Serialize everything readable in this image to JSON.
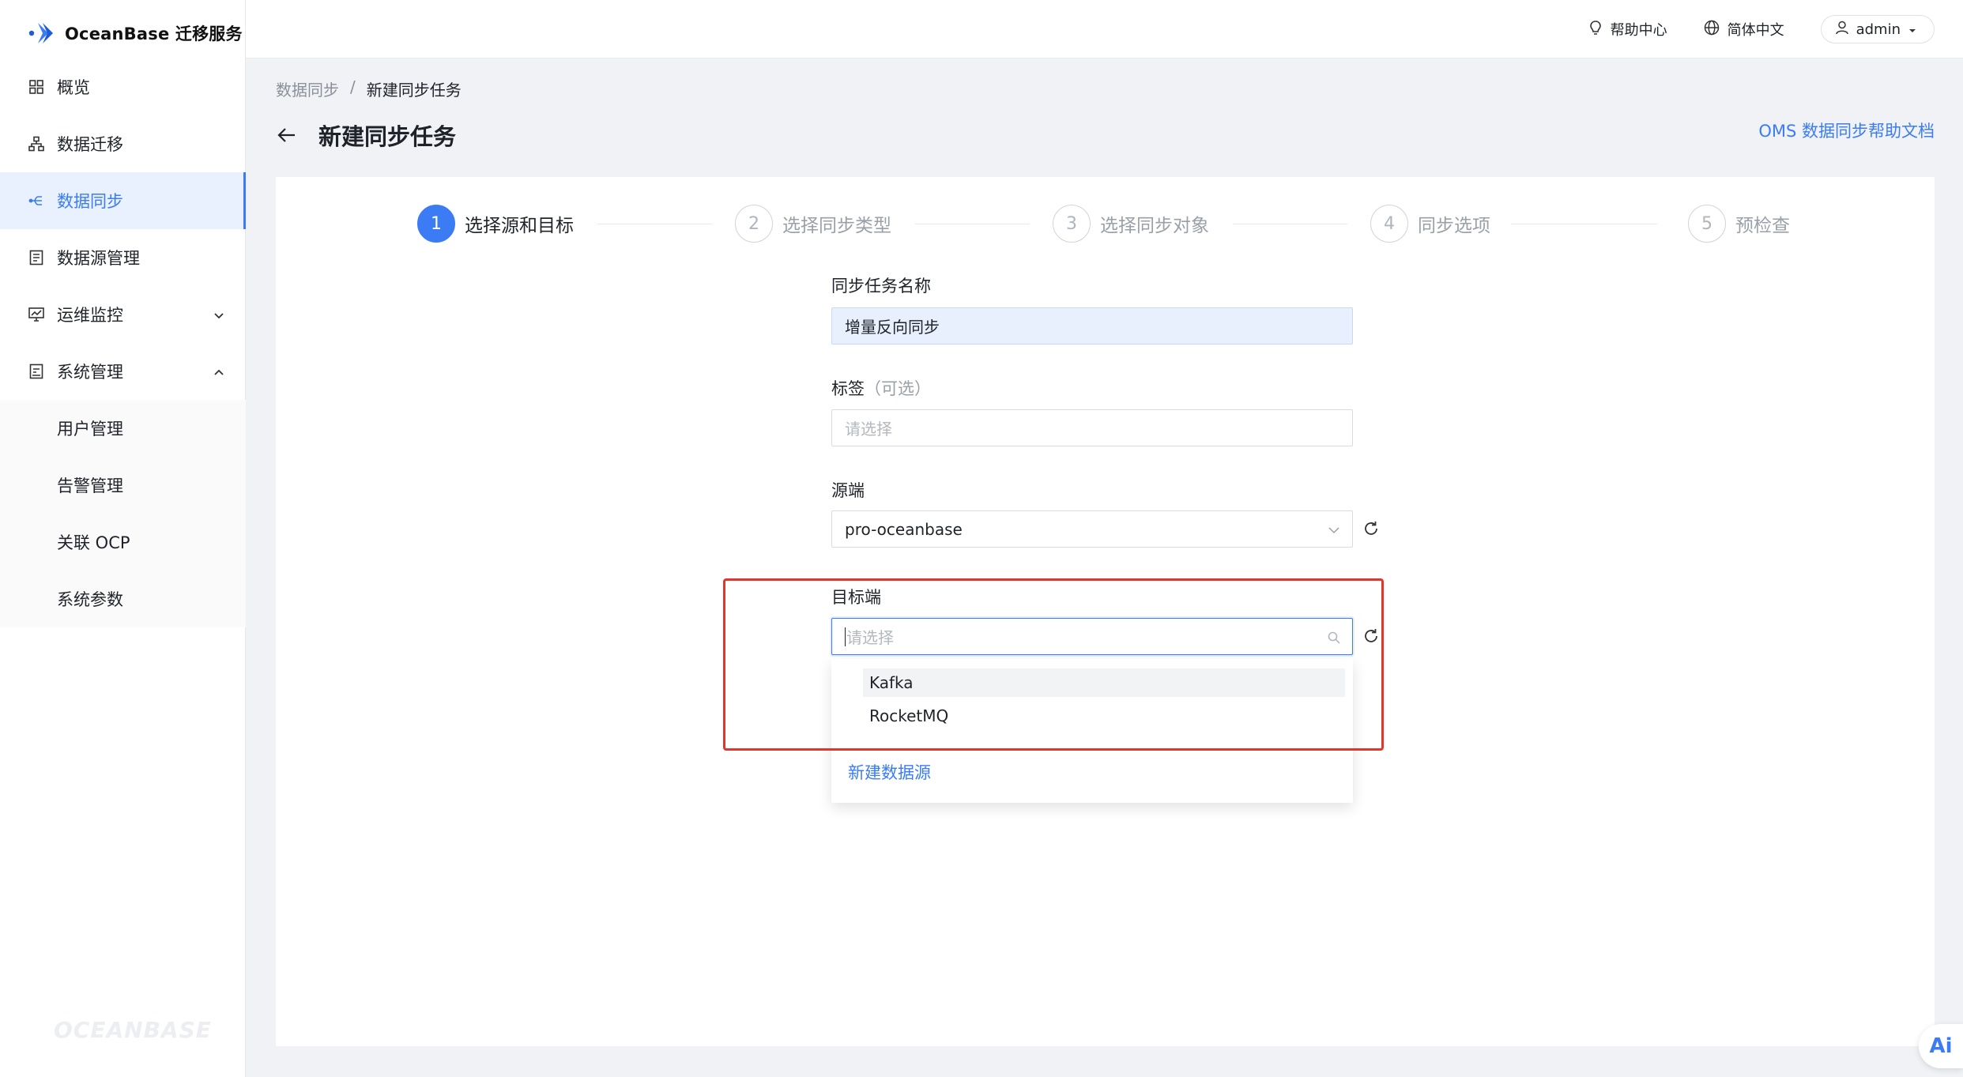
{
  "app": {
    "logo_text": "OceanBase 迁移服务",
    "footer_brand": "OCEANBASE"
  },
  "header": {
    "help": "帮助中心",
    "language": "简体中文",
    "user": "admin"
  },
  "sidebar": {
    "items": [
      {
        "label": "概览"
      },
      {
        "label": "数据迁移"
      },
      {
        "label": "数据同步"
      },
      {
        "label": "数据源管理"
      },
      {
        "label": "运维监控"
      },
      {
        "label": "系统管理"
      }
    ],
    "sub_items": [
      {
        "label": "用户管理"
      },
      {
        "label": "告警管理"
      },
      {
        "label": "关联 OCP"
      },
      {
        "label": "系统参数"
      }
    ]
  },
  "breadcrumb": {
    "parent": "数据同步",
    "separator": "/",
    "current": "新建同步任务"
  },
  "page": {
    "title": "新建同步任务",
    "doc_link": "OMS 数据同步帮助文档"
  },
  "steps": [
    {
      "num": "1",
      "label": "选择源和目标"
    },
    {
      "num": "2",
      "label": "选择同步类型"
    },
    {
      "num": "3",
      "label": "选择同步对象"
    },
    {
      "num": "4",
      "label": "同步选项"
    },
    {
      "num": "5",
      "label": "预检查"
    }
  ],
  "form": {
    "task_name": {
      "label": "同步任务名称",
      "value": "增量反向同步"
    },
    "tag": {
      "label": "标签",
      "optional": "（可选）",
      "placeholder": "请选择"
    },
    "source": {
      "label": "源端",
      "value": "pro-oceanbase"
    },
    "target": {
      "label": "目标端",
      "placeholder": "请选择"
    }
  },
  "dropdown": {
    "options": [
      "Kafka",
      "RocketMQ"
    ],
    "footer": "新建数据源"
  },
  "ai_badge": "Ai",
  "colors": {
    "primary": "#3b7cf5",
    "highlight": "#e0362c"
  }
}
